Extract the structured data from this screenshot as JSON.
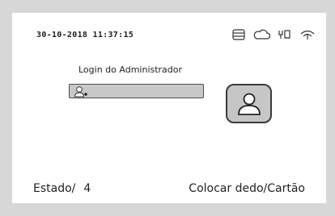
{
  "header": {
    "datetime": "30-10-2018  11:37:15",
    "icons": [
      "database-icon",
      "cloud-icon",
      "ethernet-icon",
      "wifi-icon"
    ]
  },
  "login": {
    "title": "Login do Administrador",
    "user_field_icon": "add-user-icon",
    "avatar_icon": "user-avatar-icon"
  },
  "footer": {
    "state_label": "Estado/",
    "state_value": "4",
    "action_text": "Colocar dedo/Cartão"
  }
}
